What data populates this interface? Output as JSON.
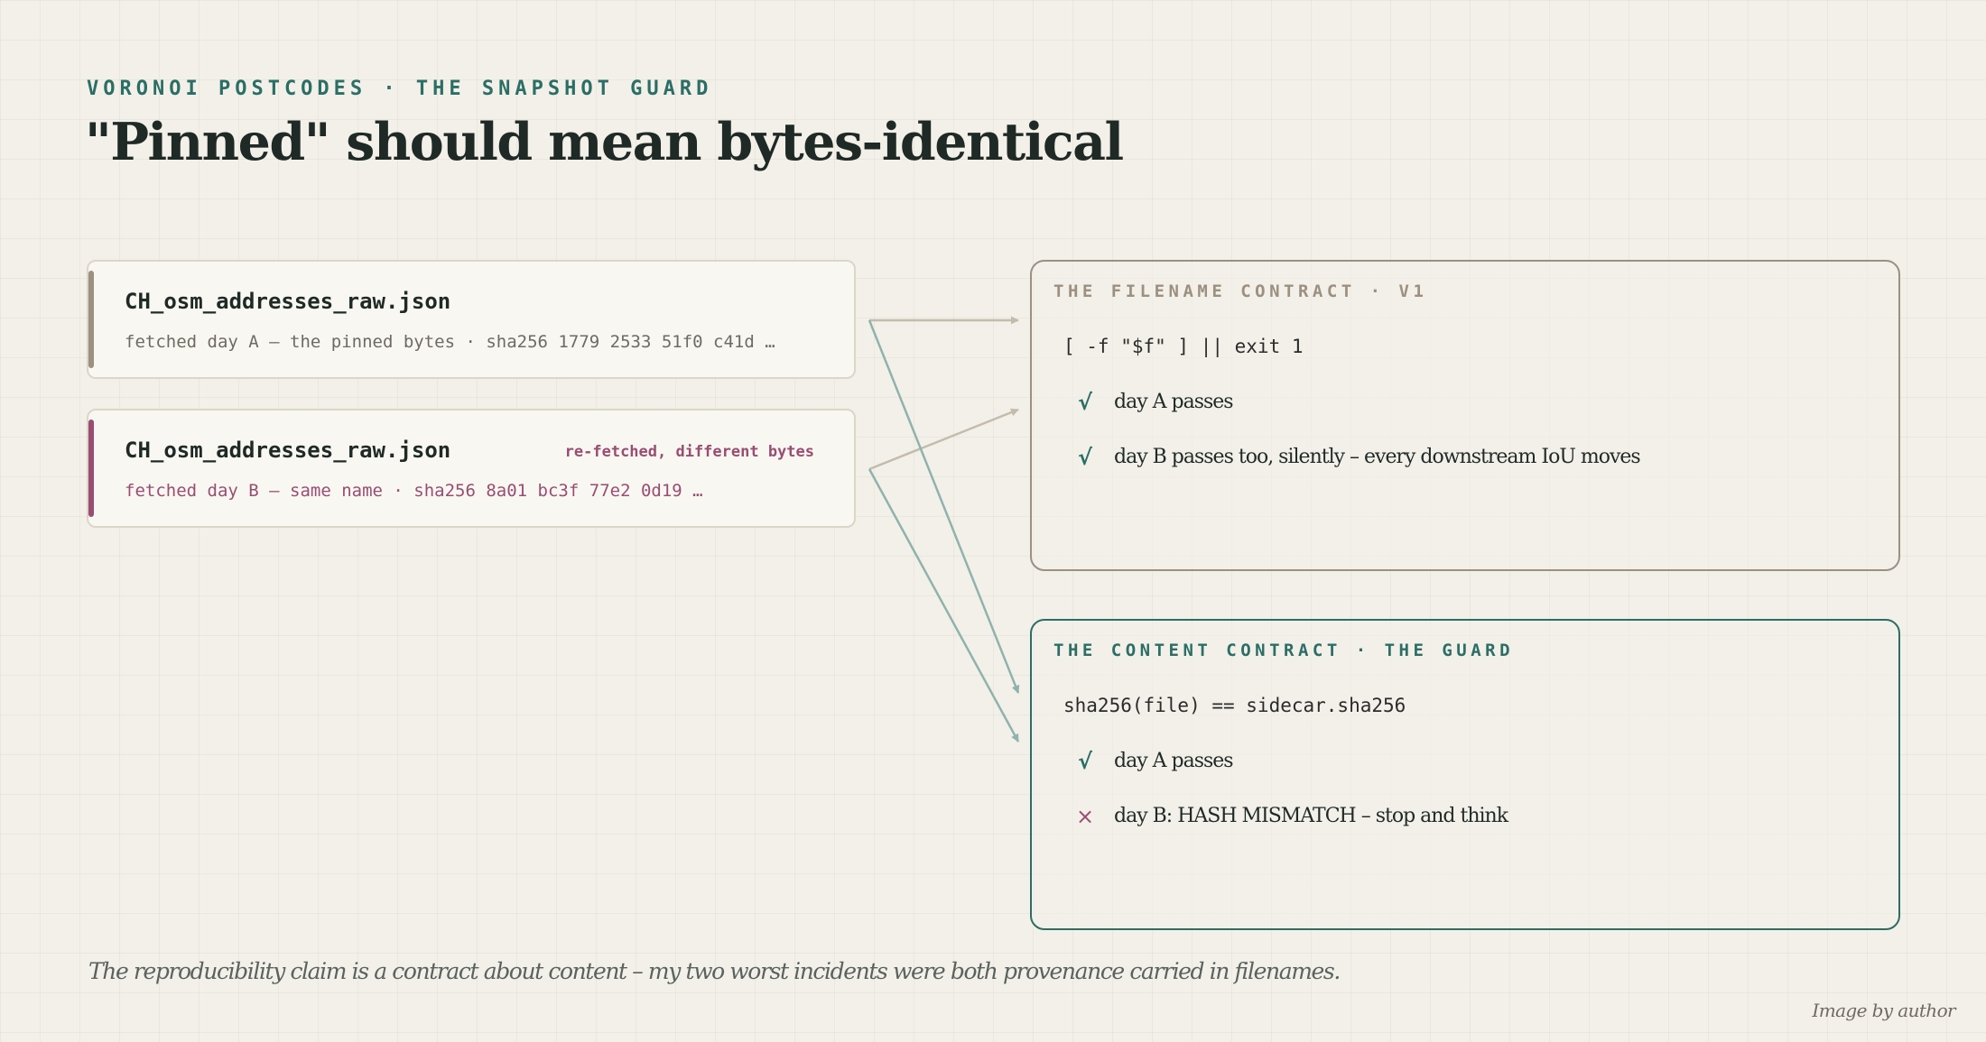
{
  "header": {
    "kicker": "VORONOI POSTCODES · THE SNAPSHOT GUARD",
    "title": "\"Pinned\" should mean bytes-identical"
  },
  "files": [
    {
      "name": "CH_osm_addresses_raw.json",
      "meta": "fetched day A — the pinned bytes · sha256 1779 2533 51f0 c41d …",
      "tag": ""
    },
    {
      "name": "CH_osm_addresses_raw.json",
      "meta": "fetched day B — same name · sha256 8a01 bc3f 77e2 0d19 …",
      "tag": "re-fetched, different bytes"
    }
  ],
  "contracts": {
    "filename": {
      "title": "THE FILENAME CONTRACT · V1",
      "code": "[ -f \"$f\" ] || exit 1",
      "checks": [
        {
          "mark": "√",
          "text": "day A passes"
        },
        {
          "mark": "√",
          "text": "day B passes too, silently – every downstream IoU moves"
        }
      ]
    },
    "content": {
      "title": "THE CONTENT CONTRACT · THE GUARD",
      "code": "sha256(file) == sidecar.sha256",
      "checks": [
        {
          "mark": "√",
          "text": "day A passes"
        },
        {
          "mark": "×",
          "text": "day B: HASH MISMATCH – stop and think"
        }
      ]
    }
  },
  "footer": "The reproducibility claim is a contract about content – my two worst incidents were both provenance carried in filenames.",
  "credit": "Image by author",
  "colors": {
    "teal": "#2a6e66",
    "taupe": "#9c9080",
    "plum": "#9a4d72",
    "arrow_grey": "#c3bcad",
    "arrow_teal": "#8fb3ac"
  }
}
